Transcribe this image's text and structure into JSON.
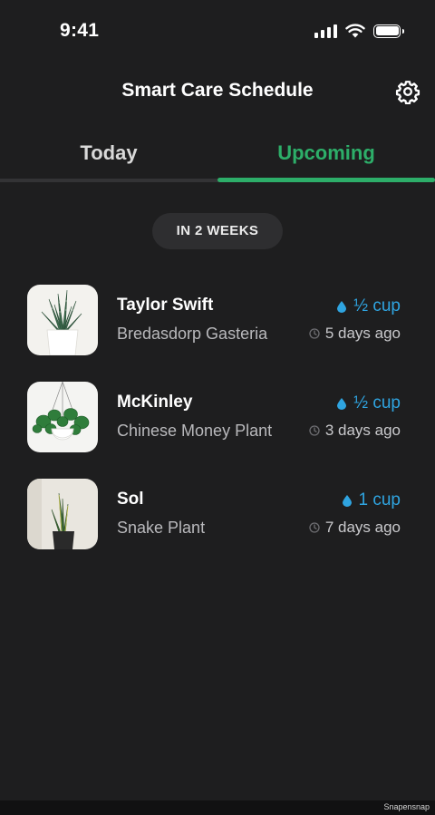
{
  "status_bar": {
    "time": "9:41"
  },
  "header": {
    "title": "Smart Care Schedule"
  },
  "tabs": [
    {
      "label": "Today",
      "active": false
    },
    {
      "label": "Upcoming",
      "active": true
    }
  ],
  "section": {
    "label": "IN 2 WEEKS"
  },
  "plants": [
    {
      "name": "Taylor Swift",
      "species": "Bredasdorp Gasteria",
      "water": "½ cup",
      "last_watered": "5 days ago"
    },
    {
      "name": "McKinley",
      "species": "Chinese Money Plant",
      "water": "½ cup",
      "last_watered": "3 days ago"
    },
    {
      "name": "Sol",
      "species": "Snake Plant",
      "water": "1 cup",
      "last_watered": "7 days ago"
    }
  ],
  "footer": {
    "watermark": "Snapensnap"
  },
  "colors": {
    "background": "#1e1e1f",
    "accent_green": "#2dae69",
    "water_blue": "#2fa4e0"
  },
  "icons": [
    "signal-icon",
    "wifi-icon",
    "battery-icon",
    "gear-icon",
    "water-drop-icon",
    "clock-icon"
  ]
}
